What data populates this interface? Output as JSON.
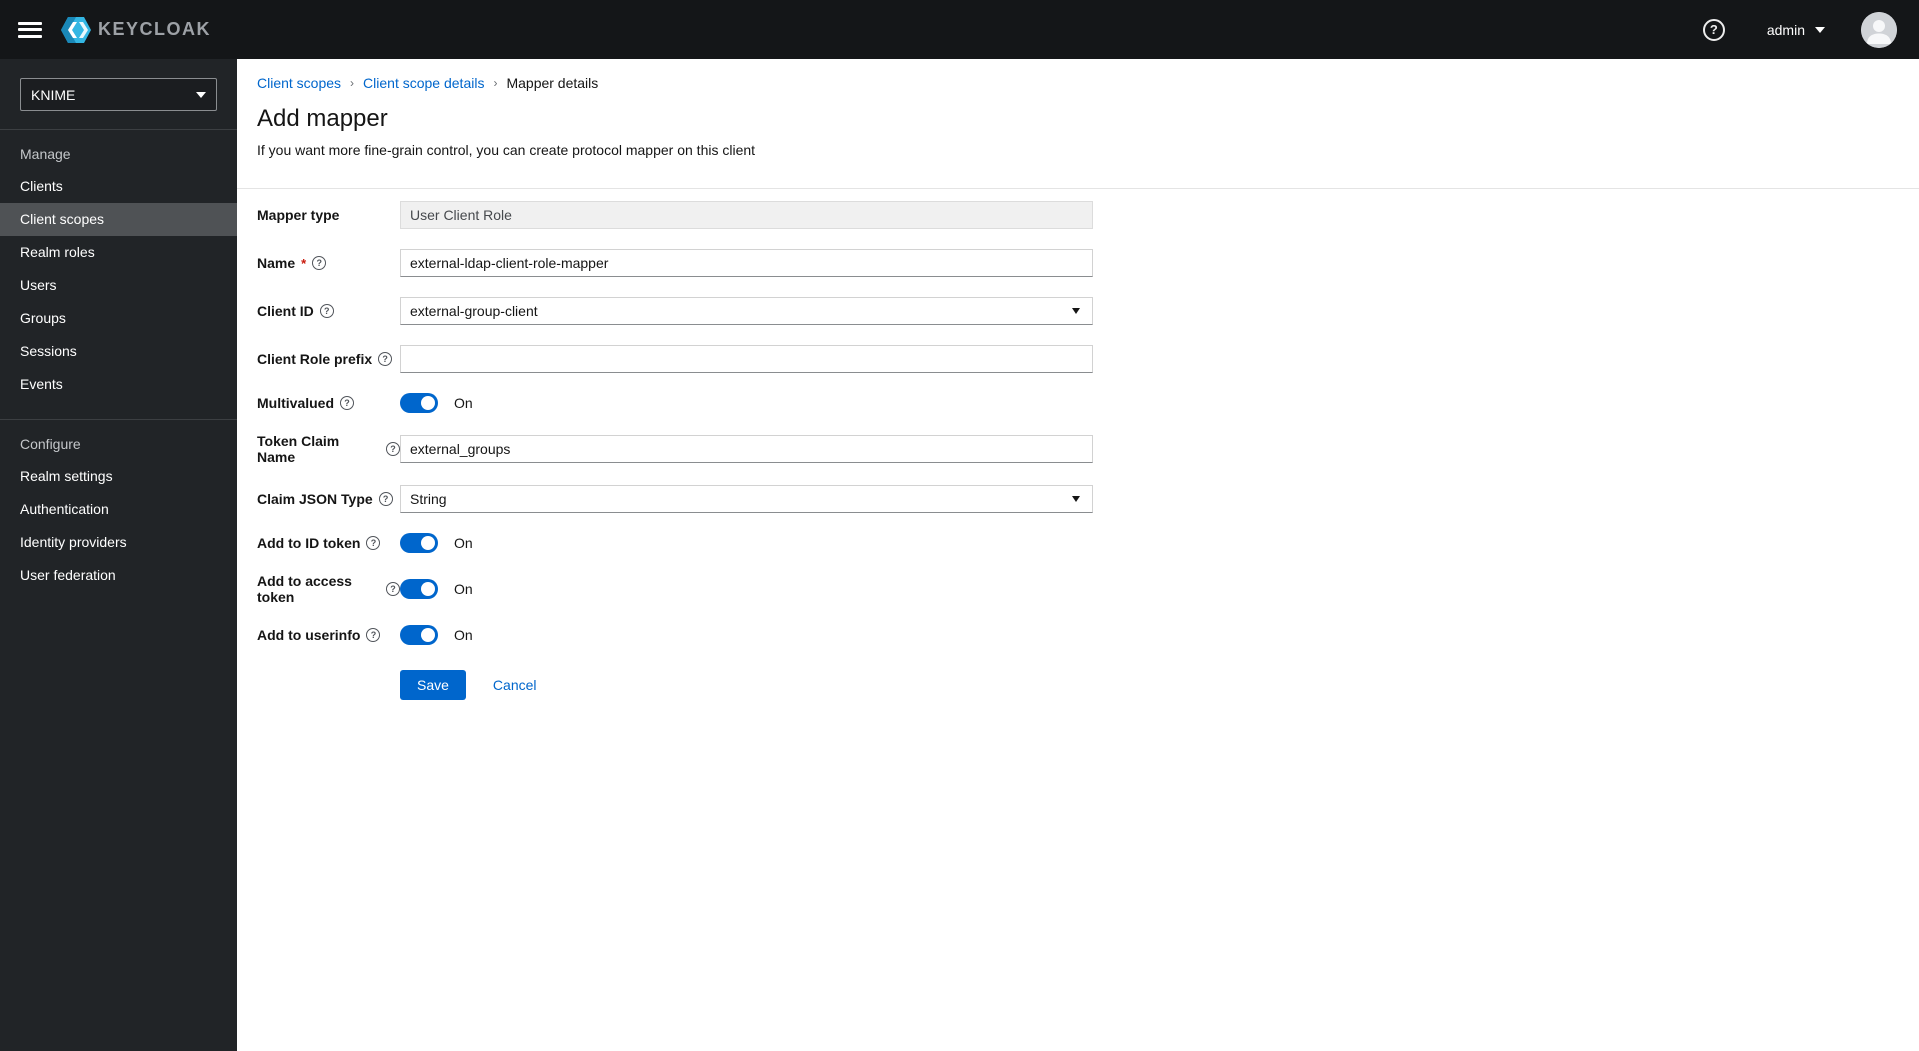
{
  "topbar": {
    "brand": "KEYCLOAK",
    "username": "admin"
  },
  "sidebar": {
    "realm": "KNIME",
    "sections": [
      {
        "label": "Manage",
        "items": [
          {
            "label": "Clients"
          },
          {
            "label": "Client scopes"
          },
          {
            "label": "Realm roles"
          },
          {
            "label": "Users"
          },
          {
            "label": "Groups"
          },
          {
            "label": "Sessions"
          },
          {
            "label": "Events"
          }
        ]
      },
      {
        "label": "Configure",
        "items": [
          {
            "label": "Realm settings"
          },
          {
            "label": "Authentication"
          },
          {
            "label": "Identity providers"
          },
          {
            "label": "User federation"
          }
        ]
      }
    ],
    "selected": "Client scopes"
  },
  "breadcrumb": {
    "items": [
      {
        "label": "Client scopes"
      },
      {
        "label": "Client scope details"
      },
      {
        "label": "Mapper details"
      }
    ],
    "separator": "›"
  },
  "page": {
    "title": "Add mapper",
    "subtitle": "If you want more fine-grain control, you can create protocol mapper on this client"
  },
  "form": {
    "mapper_type": {
      "label": "Mapper type",
      "value": "User Client Role"
    },
    "name": {
      "label": "Name",
      "required_marker": "*",
      "value": "external-ldap-client-role-mapper"
    },
    "client_id": {
      "label": "Client ID",
      "value": "external-group-client"
    },
    "client_role_prefix": {
      "label": "Client Role prefix",
      "value": ""
    },
    "multivalued": {
      "label": "Multivalued",
      "state": "On"
    },
    "token_claim_name": {
      "label": "Token Claim Name",
      "value": "external_groups"
    },
    "claim_json_type": {
      "label": "Claim JSON Type",
      "value": "String"
    },
    "add_to_id_token": {
      "label": "Add to ID token",
      "state": "On"
    },
    "add_to_access_token": {
      "label": "Add to access token",
      "state": "On"
    },
    "add_to_userinfo": {
      "label": "Add to userinfo",
      "state": "On"
    },
    "actions": {
      "save": "Save",
      "cancel": "Cancel"
    }
  },
  "icons": {
    "help": "?"
  },
  "colors": {
    "accent": "#0066cc",
    "toggle_on": "#0066cc",
    "required": "#c9190b",
    "topbar_bg": "#141618",
    "sidebar_bg": "#212427"
  }
}
